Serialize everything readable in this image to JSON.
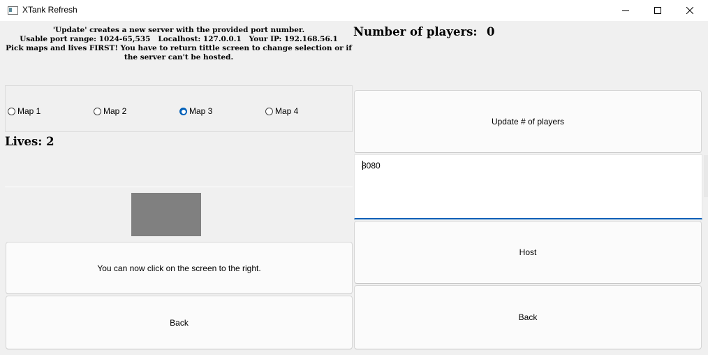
{
  "window": {
    "title": "XTank Refresh",
    "controls": [
      "minimize",
      "maximize",
      "close"
    ]
  },
  "info": {
    "line1": "'Update' creates a new server with the provided port number.",
    "line2": "Usable port range: 1024-65,535   Localhost: 127.0.0.1   Your IP: 192.168.56.1",
    "line3": "Pick maps and lives FIRST! You have to return tittle screen to change selection or if the server can't be hosted."
  },
  "players": {
    "label": "Number of players:",
    "value": "0"
  },
  "maps": {
    "options": [
      "Map 1",
      "Map 2",
      "Map 3",
      "Map 4"
    ],
    "selected": "Map 3"
  },
  "lives": {
    "label": "Lives: 2"
  },
  "status": {
    "message": "You can now click on the screen to the right."
  },
  "buttons": {
    "update": "Update # of players",
    "host": "Host",
    "back_left": "Back",
    "back_right": "Back"
  },
  "port": {
    "value": "8080"
  },
  "colors": {
    "accent": "#005fb8",
    "preview_box": "#808080",
    "background": "#f0f0f0"
  }
}
